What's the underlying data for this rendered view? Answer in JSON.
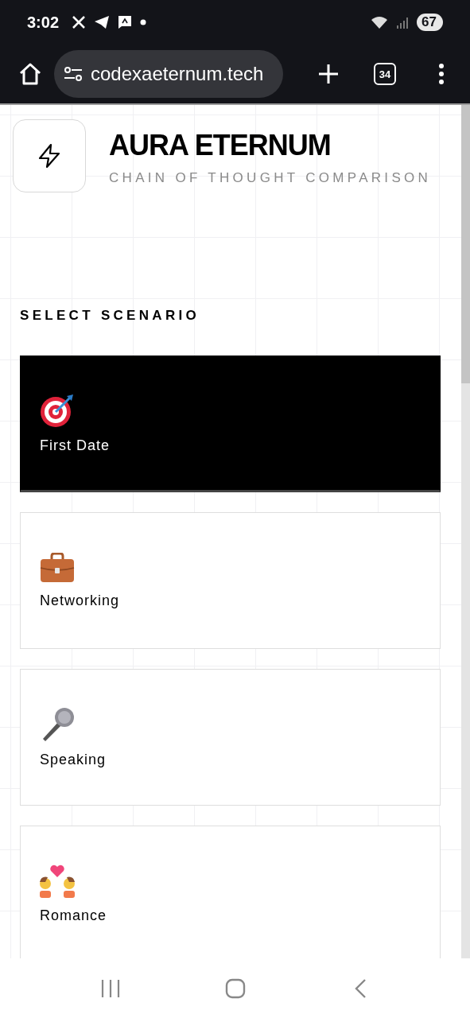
{
  "status_bar": {
    "time": "3:02",
    "battery": "67"
  },
  "browser": {
    "url": "codexaeternum.tech",
    "tab_count": "34"
  },
  "header": {
    "title": "AURA ETERNUM",
    "subtitle": "CHAIN OF THOUGHT COMPARISON"
  },
  "section_title": "SELECT SCENARIO",
  "scenarios": [
    {
      "label": "First Date",
      "kind": "target",
      "selected": true
    },
    {
      "label": "Networking",
      "kind": "briefcase",
      "selected": false
    },
    {
      "label": "Speaking",
      "kind": "microphone",
      "selected": false
    },
    {
      "label": "Romance",
      "kind": "couple",
      "selected": false
    }
  ]
}
